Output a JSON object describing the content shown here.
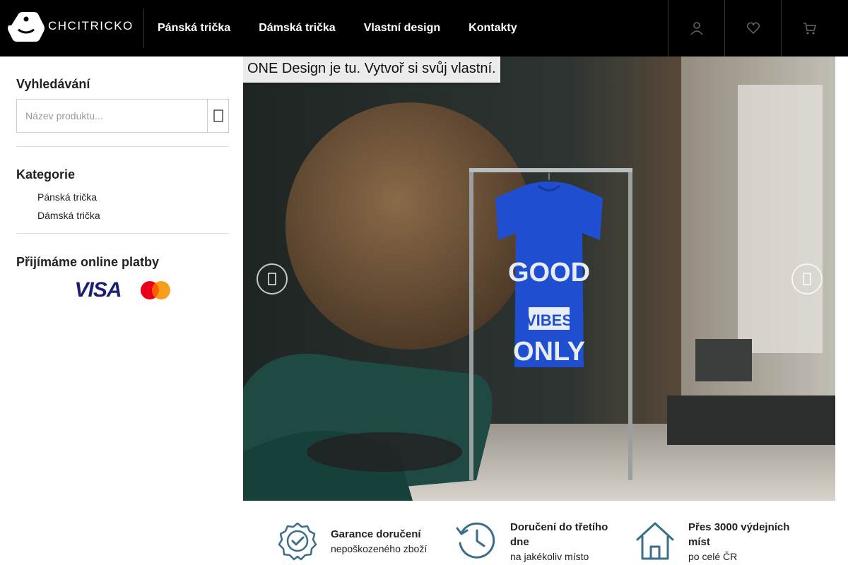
{
  "header": {
    "logo_text": "CHCITRICKO",
    "nav": [
      "Pánská trička",
      "Dámská trička",
      "Vlastní design",
      "Kontakty"
    ],
    "icons": [
      "user-icon",
      "heart-icon",
      "cart-icon"
    ]
  },
  "sidebar": {
    "search_title": "Vyhledávání",
    "search_placeholder": "Název produktu...",
    "categories_title": "Kategorie",
    "categories": [
      "Pánská trička",
      "Dámská trička"
    ],
    "payments_title": "Přijímáme online platby",
    "payment_visa": "VISA"
  },
  "hero": {
    "caption": "ONE Design je tu. Vytvoř si svůj vlastní.",
    "shirt_text": [
      "GOOD",
      "VIBES",
      "ONLY"
    ]
  },
  "features": [
    {
      "icon": "badge-check-icon",
      "title": "Garance doručení",
      "subtitle": "nepoškozeného zboží"
    },
    {
      "icon": "clock-history-icon",
      "title": "Doručení do třetího dne",
      "subtitle": "na jakékoliv místo"
    },
    {
      "icon": "house-icon",
      "title": "Přes 3000 výdejních míst",
      "subtitle": "po celé ČR"
    }
  ],
  "colors": {
    "header_bg": "#000000",
    "accent": "#3b6e8a",
    "shirt": "#1f4fd0"
  }
}
